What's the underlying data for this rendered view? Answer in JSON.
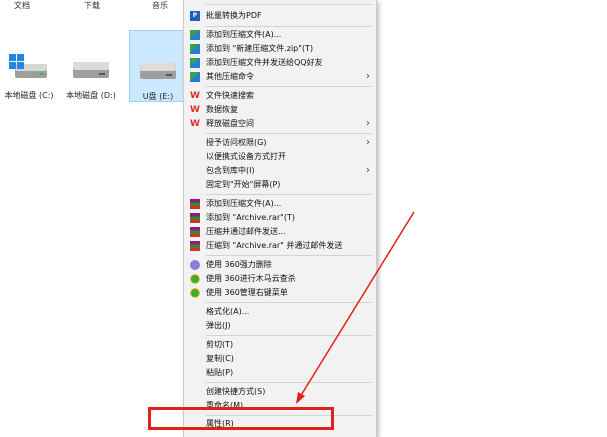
{
  "folders": [
    "文档",
    "下载",
    "音乐"
  ],
  "drives": [
    {
      "label": "本地磁盘 (C:)",
      "icon": "windows-drive-icon",
      "selected": false
    },
    {
      "label": "本地磁盘 (D:)",
      "icon": "hard-drive-icon",
      "selected": false
    },
    {
      "label": "U盘 (E:)",
      "icon": "hard-drive-icon",
      "selected": true
    }
  ],
  "menu": {
    "items": [
      {
        "label": "批量转换为PDF",
        "icon": "pdf-icon",
        "submenu": false
      },
      {
        "label": "添加到压缩文件(A)...",
        "icon": "zip-icon",
        "submenu": false
      },
      {
        "label": "添加到 \"新建压缩文件.zip\"(T)",
        "icon": "zip-icon",
        "submenu": false
      },
      {
        "label": "添加到压缩文件并发送给QQ好友",
        "icon": "zip-icon",
        "submenu": false
      },
      {
        "label": "其他压缩命令",
        "icon": "zip-icon",
        "submenu": true
      },
      {
        "label": "文件快速搜索",
        "icon": "wps-icon",
        "submenu": false
      },
      {
        "label": "数据恢复",
        "icon": "wps-icon",
        "submenu": false
      },
      {
        "label": "释放磁盘空间",
        "icon": "wps-icon",
        "submenu": true
      },
      {
        "label": "授予访问权限(G)",
        "icon": "",
        "submenu": true
      },
      {
        "label": "以便携式设备方式打开",
        "icon": "",
        "submenu": false
      },
      {
        "label": "包含到库中(I)",
        "icon": "",
        "submenu": true
      },
      {
        "label": "固定到\"开始\"屏幕(P)",
        "icon": "",
        "submenu": false
      },
      {
        "label": "添加到压缩文件(A)...",
        "icon": "winrar-icon",
        "submenu": false
      },
      {
        "label": "添加到 \"Archive.rar\"(T)",
        "icon": "winrar-icon",
        "submenu": false
      },
      {
        "label": "压缩并通过邮件发送...",
        "icon": "winrar-icon",
        "submenu": false
      },
      {
        "label": "压缩到 \"Archive.rar\" 并通过邮件发送",
        "icon": "winrar-icon",
        "submenu": false
      },
      {
        "label": "使用 360强力删除",
        "icon": "360-delete-icon",
        "submenu": false
      },
      {
        "label": "使用 360进行木马云查杀",
        "icon": "360-scan-icon",
        "submenu": false
      },
      {
        "label": "使用 360管理右键菜单",
        "icon": "360-scan-icon",
        "submenu": false
      },
      {
        "label": "格式化(A)...",
        "icon": "",
        "submenu": false
      },
      {
        "label": "弹出(J)",
        "icon": "",
        "submenu": false
      },
      {
        "label": "剪切(T)",
        "icon": "",
        "submenu": false
      },
      {
        "label": "复制(C)",
        "icon": "",
        "submenu": false
      },
      {
        "label": "粘贴(P)",
        "icon": "",
        "submenu": false
      },
      {
        "label": "创建快捷方式(S)",
        "icon": "",
        "submenu": false
      },
      {
        "label": "重命名(M)",
        "icon": "",
        "submenu": false
      },
      {
        "label": "属性(R)",
        "icon": "",
        "submenu": false
      }
    ]
  },
  "colors": {
    "highlight_box": "#e3211b",
    "selection": "#cce8ff"
  }
}
